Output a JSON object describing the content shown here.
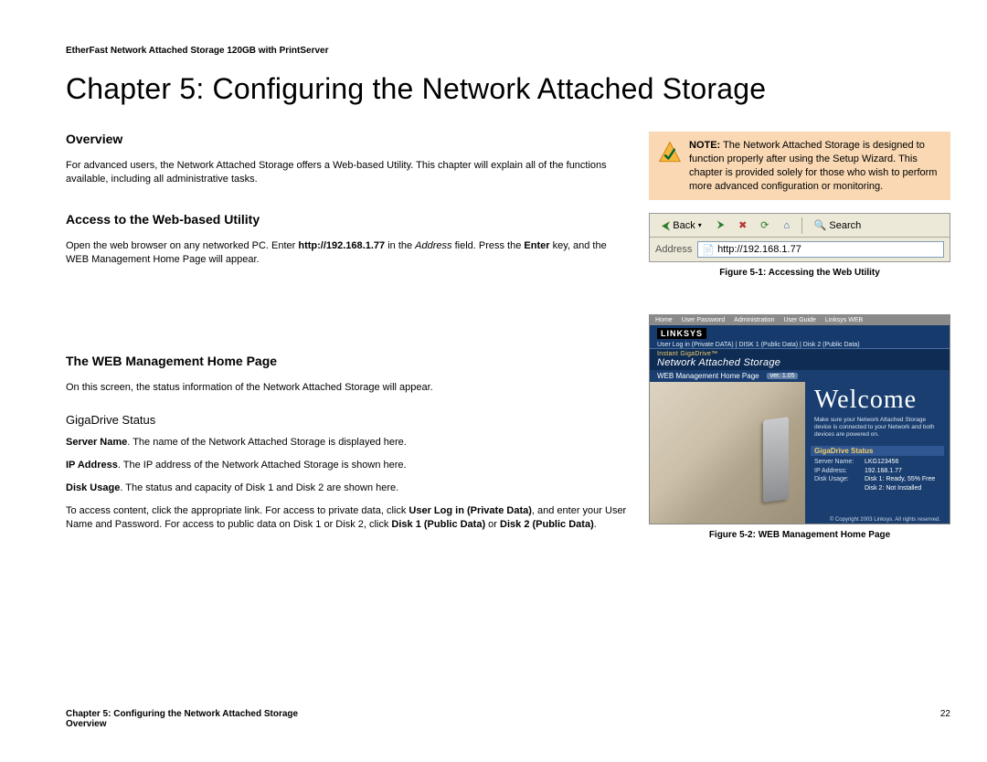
{
  "doc_header": "EtherFast Network Attached Storage 120GB with PrintServer",
  "chapter_title": "Chapter 5: Configuring the Network Attached Storage",
  "sections": {
    "overview": {
      "heading": "Overview",
      "body": "For advanced users, the Network Attached Storage offers a Web-based Utility. This chapter will explain all of the functions available, including all administrative tasks."
    },
    "access": {
      "heading": "Access to the Web-based Utility",
      "pre": "Open the web browser on any networked PC. Enter ",
      "url_bold": "http://192.168.1.77",
      "mid": " in the ",
      "address_italic": "Address",
      "post1": " field. Press the ",
      "enter_bold": "Enter",
      "post2": " key, and the WEB Management Home Page will appear."
    },
    "homepage": {
      "heading": "The WEB Management Home Page",
      "body": "On this screen, the status information of the Network Attached Storage will appear.",
      "sub": "GigaDrive Status",
      "p1_bold": "Server Name",
      "p1": ". The name of the Network Attached Storage is displayed here.",
      "p2_bold": "IP Address",
      "p2": ". The IP address of the Network Attached Storage is shown here.",
      "p3_bold": "Disk Usage",
      "p3": ". The status and capacity of Disk 1 and Disk 2 are shown here.",
      "p4_pre": "To access content, click the appropriate link. For access to private data, click ",
      "p4_b1": "User Log in (Private Data)",
      "p4_mid": ", and enter your User Name and Password. For access to public data on Disk 1 or Disk 2, click ",
      "p4_b2": "Disk 1 (Public Data)",
      "p4_or": " or ",
      "p4_b3": "Disk 2 (Public Data)",
      "p4_post": "."
    }
  },
  "note": {
    "label_bold": "NOTE:",
    "text": " The Network Attached Storage is designed to function properly after using the Setup Wizard. This chapter is provided solely for those who wish to perform more advanced configuration or monitoring."
  },
  "browser_mock": {
    "back": "Back",
    "search": "Search",
    "address_label": "Address",
    "address_value": "http://192.168.1.77"
  },
  "fig1_caption": "Figure 5-1: Accessing the Web Utility",
  "webmgmt": {
    "logo": "LINKSYS",
    "top_links": [
      "Home",
      "User Password",
      "Administration",
      "User Guide",
      "Linksys WEB"
    ],
    "tabbar": "User Log in (Private DATA)  |  DISK 1 (Public Data)  |  Disk 2 (Public Data)",
    "pretitle": "Instant GigaDrive™",
    "title": "Network Attached Storage",
    "subbar": "WEB Management Home Page",
    "ver": "ver. 1.05",
    "welcome": "Welcome",
    "sub": "Make sure your Network Attached Storage device is connected to your Network and both devices are powered on.",
    "status_head": "GigaDrive Status",
    "rows": [
      {
        "k": "Server Name:",
        "v": "LKG123456"
      },
      {
        "k": "IP Address:",
        "v": "192.168.1.77"
      },
      {
        "k": "Disk Usage:",
        "v": "Disk 1: Ready, 55% Free"
      },
      {
        "k": "",
        "v": "Disk 2: Not Installed"
      }
    ],
    "foot": "© Copyright 2003 Linksys. All rights reserved."
  },
  "fig2_caption": "Figure 5-2: WEB Management Home Page",
  "footer": {
    "line1": "Chapter 5: Configuring the Network Attached Storage",
    "line2": "Overview",
    "page": "22"
  }
}
